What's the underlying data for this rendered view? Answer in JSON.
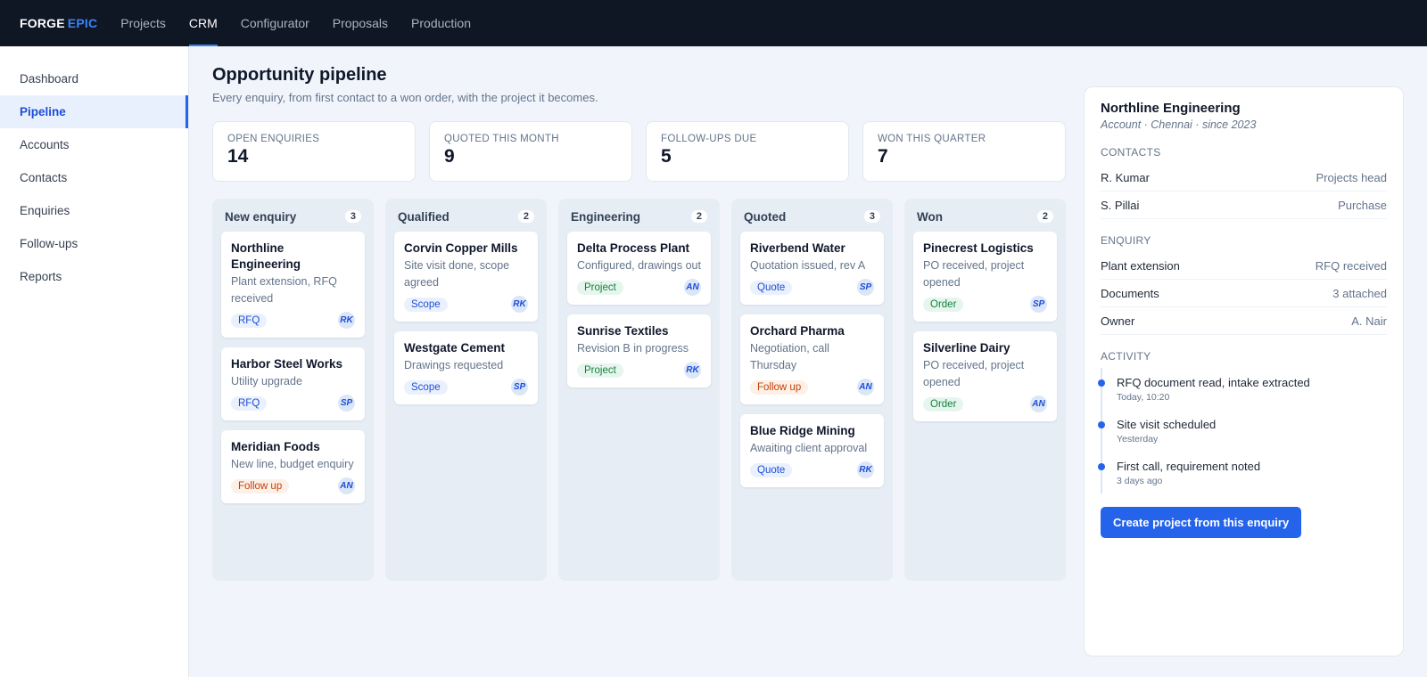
{
  "brand": {
    "name": "FORGE",
    "accent": "EPIC"
  },
  "topnav": [
    {
      "label": "Projects",
      "active": false
    },
    {
      "label": "CRM",
      "active": true
    },
    {
      "label": "Configurator",
      "active": false
    },
    {
      "label": "Proposals",
      "active": false
    },
    {
      "label": "Production",
      "active": false
    }
  ],
  "sidebar": {
    "items": [
      {
        "label": "Dashboard"
      },
      {
        "label": "Pipeline"
      },
      {
        "label": "Accounts"
      },
      {
        "label": "Contacts"
      },
      {
        "label": "Enquiries"
      },
      {
        "label": "Follow-ups"
      },
      {
        "label": "Reports"
      }
    ],
    "active_index": 1
  },
  "page": {
    "title": "Opportunity pipeline",
    "subtitle": "Every enquiry, from first contact to a won order, with the project it becomes."
  },
  "stats": [
    {
      "label": "Open enquiries",
      "value": "14"
    },
    {
      "label": "Quoted this month",
      "value": "9"
    },
    {
      "label": "Follow-ups due",
      "value": "5"
    },
    {
      "label": "Won this quarter",
      "value": "7"
    }
  ],
  "columns": [
    {
      "title": "New enquiry",
      "count": "3",
      "cards": [
        {
          "title": "Northline Engineering",
          "desc": "Plant extension, RFQ received",
          "tag": "RFQ",
          "tag_color": "blue",
          "avatar": "RK"
        },
        {
          "title": "Harbor Steel Works",
          "desc": "Utility upgrade",
          "tag": "RFQ",
          "tag_color": "blue",
          "avatar": "SP"
        },
        {
          "title": "Meridian Foods",
          "desc": "New line, budget enquiry",
          "tag": "Follow up",
          "tag_color": "orange",
          "avatar": "AN"
        }
      ]
    },
    {
      "title": "Qualified",
      "count": "2",
      "cards": [
        {
          "title": "Corvin Copper Mills",
          "desc": "Site visit done, scope agreed",
          "tag": "Scope",
          "tag_color": "blue",
          "avatar": "RK"
        },
        {
          "title": "Westgate Cement",
          "desc": "Drawings requested",
          "tag": "Scope",
          "tag_color": "blue",
          "avatar": "SP"
        }
      ]
    },
    {
      "title": "Engineering",
      "count": "2",
      "cards": [
        {
          "title": "Delta Process Plant",
          "desc": "Configured, drawings out",
          "tag": "Project",
          "tag_color": "green",
          "avatar": "AN"
        },
        {
          "title": "Sunrise Textiles",
          "desc": "Revision B in progress",
          "tag": "Project",
          "tag_color": "green",
          "avatar": "RK"
        }
      ]
    },
    {
      "title": "Quoted",
      "count": "3",
      "cards": [
        {
          "title": "Riverbend Water",
          "desc": "Quotation issued, rev A",
          "tag": "Quote",
          "tag_color": "blue",
          "avatar": "SP"
        },
        {
          "title": "Orchard Pharma",
          "desc": "Negotiation, call Thursday",
          "tag": "Follow up",
          "tag_color": "orange",
          "avatar": "AN"
        },
        {
          "title": "Blue Ridge Mining",
          "desc": "Awaiting client approval",
          "tag": "Quote",
          "tag_color": "blue",
          "avatar": "RK"
        }
      ]
    },
    {
      "title": "Won",
      "count": "2",
      "cards": [
        {
          "title": "Pinecrest Logistics",
          "desc": "PO received, project opened",
          "tag": "Order",
          "tag_color": "green",
          "avatar": "SP"
        },
        {
          "title": "Silverline Dairy",
          "desc": "PO received, project opened",
          "tag": "Order",
          "tag_color": "green",
          "avatar": "AN"
        }
      ]
    }
  ],
  "detail": {
    "account_name": "Northline Engineering",
    "account_sub": "Account · Chennai · since 2023",
    "contacts_heading": "Contacts",
    "contacts": [
      {
        "name": "R. Kumar",
        "role": "Projects head"
      },
      {
        "name": "S. Pillai",
        "role": "Purchase"
      }
    ],
    "enquiry_heading": "Enquiry",
    "enquiry": [
      {
        "key": "Plant extension",
        "value": "RFQ received"
      },
      {
        "key": "Documents",
        "value": "3 attached"
      },
      {
        "key": "Owner",
        "value": "A. Nair"
      }
    ],
    "activity_heading": "Activity",
    "activity": [
      {
        "text": "RFQ document read, intake extracted",
        "time": "Today, 10:20"
      },
      {
        "text": "Site visit scheduled",
        "time": "Yesterday"
      },
      {
        "text": "First call, requirement noted",
        "time": "3 days ago"
      }
    ],
    "cta_label": "Create project from this enquiry"
  },
  "colors": {
    "topbar_bg": "#0f1624",
    "accent": "#2563eb",
    "tag_blue": "#1d4ed8",
    "tag_green": "#15803d",
    "tag_orange": "#c2410c"
  }
}
